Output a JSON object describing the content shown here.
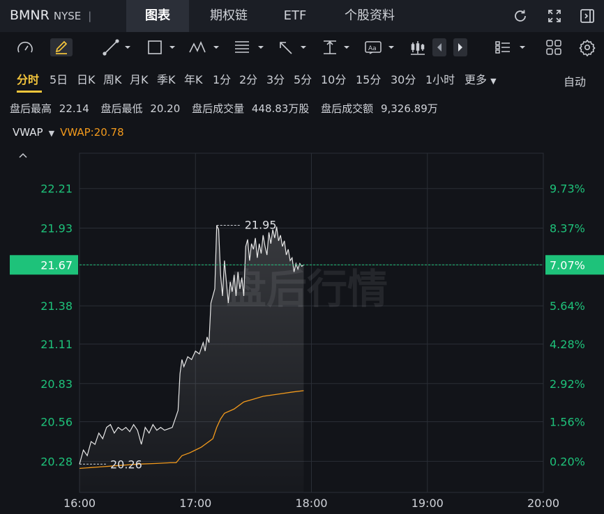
{
  "header": {
    "symbol": "BMNR",
    "exchange": "NYSE",
    "separator": "|",
    "tabs": [
      {
        "label": "图表",
        "active": true
      },
      {
        "label": "期权链",
        "active": false
      },
      {
        "label": "ETF",
        "active": false
      },
      {
        "label": "个股资料",
        "active": false
      }
    ],
    "icons": [
      "refresh-icon",
      "fullscreen-icon",
      "collapse-panel-icon"
    ]
  },
  "toolbar": {
    "icons": [
      "gauge-icon",
      "draw-pen-icon",
      "trend-line-icon",
      "rectangle-icon",
      "pattern-icon",
      "fibonacci-icon",
      "arrow-icon",
      "measure-icon",
      "text-annotation-icon",
      "candlestick-icon",
      "prev-arrow-icon",
      "next-arrow-icon",
      "layout-list-icon",
      "grid-layout-icon",
      "settings-icon"
    ]
  },
  "periods": {
    "items": [
      "分时",
      "5日",
      "日K",
      "周K",
      "月K",
      "季K",
      "年K",
      "1分",
      "2分",
      "3分",
      "5分",
      "10分",
      "15分",
      "30分",
      "1小时"
    ],
    "active": "分时",
    "more": "更多",
    "more_arrow": "▼",
    "auto": "自动"
  },
  "stats": [
    {
      "label": "盘后最高",
      "value": "22.14"
    },
    {
      "label": "盘后最低",
      "value": "20.20"
    },
    {
      "label": "盘后成交量",
      "value": "448.83万股"
    },
    {
      "label": "盘后成交额",
      "value": "9,326.89万"
    }
  ],
  "indicator": {
    "name": "VWAP",
    "arrow": "▼",
    "value_text": "VWAP:20.78"
  },
  "colors": {
    "up": "#1ec27a",
    "vwap": "#f39a1c",
    "price_line": "#e8e8e8",
    "current_label_bg": "#1ec27a"
  },
  "chart_data": {
    "type": "line",
    "watermark": "盘后行情",
    "x_ticks": [
      "16:00",
      "17:00",
      "18:00",
      "19:00",
      "20:00"
    ],
    "xlim": [
      "16:00",
      "20:00"
    ],
    "y_ticks": [
      "22.21",
      "21.93",
      "21.67",
      "21.38",
      "21.11",
      "20.83",
      "20.56",
      "20.28"
    ],
    "ylim": [
      20.06,
      22.46
    ],
    "y_percent_ticks": [
      "9.73%",
      "8.37%",
      "7.07%",
      "5.64%",
      "4.28%",
      "2.92%",
      "1.56%",
      "0.20%"
    ],
    "current_price": "21.67",
    "current_percent": "7.07%",
    "high_annotation": "21.95",
    "low_annotation": "20.26",
    "series": [
      {
        "name": "price",
        "color": "#e8e8e8",
        "points": [
          [
            0,
            20.26
          ],
          [
            2,
            20.36
          ],
          [
            4,
            20.32
          ],
          [
            6,
            20.42
          ],
          [
            8,
            20.4
          ],
          [
            10,
            20.48
          ],
          [
            12,
            20.44
          ],
          [
            14,
            20.52
          ],
          [
            16,
            20.54
          ],
          [
            18,
            20.48
          ],
          [
            20,
            20.52
          ],
          [
            22,
            20.5
          ],
          [
            24,
            20.52
          ],
          [
            26,
            20.49
          ],
          [
            28,
            20.54
          ],
          [
            30,
            20.5
          ],
          [
            32,
            20.4
          ],
          [
            34,
            20.52
          ],
          [
            36,
            20.48
          ],
          [
            38,
            20.54
          ],
          [
            40,
            20.5
          ],
          [
            42,
            20.52
          ],
          [
            44,
            20.5
          ],
          [
            46,
            20.51
          ],
          [
            48,
            20.52
          ],
          [
            50,
            20.6
          ],
          [
            51,
            20.64
          ],
          [
            52,
            20.9
          ],
          [
            53,
            21.0
          ],
          [
            54,
            20.95
          ],
          [
            56,
            21.02
          ],
          [
            58,
            21.0
          ],
          [
            60,
            21.06
          ],
          [
            62,
            21.04
          ],
          [
            64,
            21.12
          ],
          [
            65,
            21.06
          ],
          [
            66,
            21.16
          ],
          [
            67,
            21.12
          ],
          [
            68,
            21.4
          ],
          [
            70,
            21.5
          ],
          [
            71,
            21.95
          ],
          [
            72,
            21.92
          ],
          [
            73,
            21.6
          ],
          [
            74,
            21.45
          ],
          [
            75,
            21.7
          ],
          [
            76,
            21.55
          ],
          [
            77,
            21.4
          ],
          [
            78,
            21.55
          ],
          [
            79,
            21.48
          ],
          [
            80,
            21.6
          ],
          [
            81,
            21.45
          ],
          [
            82,
            21.62
          ],
          [
            83,
            21.5
          ],
          [
            84,
            21.58
          ],
          [
            85,
            21.45
          ],
          [
            86,
            21.8
          ],
          [
            87,
            21.85
          ],
          [
            88,
            21.7
          ],
          [
            89,
            21.82
          ],
          [
            90,
            21.78
          ],
          [
            91,
            21.86
          ],
          [
            92,
            21.72
          ],
          [
            93,
            21.82
          ],
          [
            94,
            21.75
          ],
          [
            95,
            21.88
          ],
          [
            96,
            21.8
          ],
          [
            97,
            21.74
          ],
          [
            98,
            21.9
          ],
          [
            99,
            21.82
          ],
          [
            100,
            21.92
          ],
          [
            101,
            21.86
          ],
          [
            102,
            21.94
          ],
          [
            103,
            21.84
          ],
          [
            104,
            21.88
          ],
          [
            105,
            21.8
          ],
          [
            106,
            21.84
          ],
          [
            107,
            21.74
          ],
          [
            108,
            21.78
          ],
          [
            109,
            21.7
          ],
          [
            110,
            21.72
          ],
          [
            111,
            21.62
          ],
          [
            112,
            21.68
          ],
          [
            113,
            21.64
          ],
          [
            114,
            21.68
          ],
          [
            115,
            21.66
          ],
          [
            116,
            21.67
          ]
        ]
      },
      {
        "name": "VWAP",
        "color": "#f39a1c",
        "points": [
          [
            0,
            20.23
          ],
          [
            10,
            20.24
          ],
          [
            20,
            20.25
          ],
          [
            30,
            20.26
          ],
          [
            40,
            20.265
          ],
          [
            47,
            20.27
          ],
          [
            50,
            20.27
          ],
          [
            53,
            20.32
          ],
          [
            57,
            20.34
          ],
          [
            60,
            20.36
          ],
          [
            63,
            20.38
          ],
          [
            65,
            20.4
          ],
          [
            67,
            20.42
          ],
          [
            69,
            20.44
          ],
          [
            71,
            20.52
          ],
          [
            73,
            20.58
          ],
          [
            75,
            20.62
          ],
          [
            80,
            20.65
          ],
          [
            85,
            20.7
          ],
          [
            90,
            20.72
          ],
          [
            95,
            20.74
          ],
          [
            100,
            20.75
          ],
          [
            105,
            20.76
          ],
          [
            110,
            20.77
          ],
          [
            116,
            20.78
          ]
        ]
      }
    ]
  }
}
